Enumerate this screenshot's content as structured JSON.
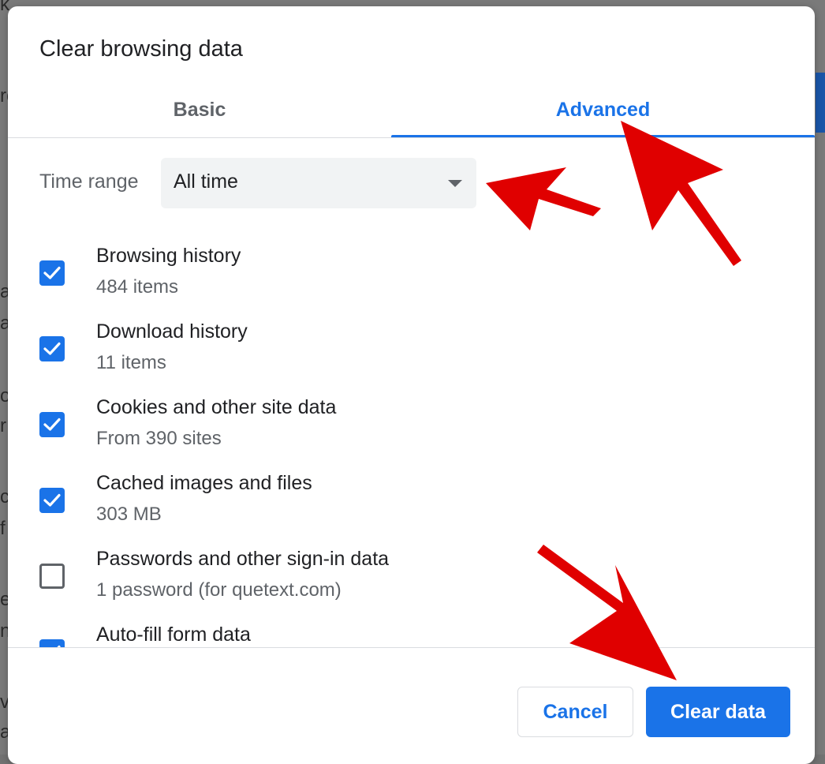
{
  "background": {
    "fragments": [
      "k",
      "rc",
      "a",
      "a",
      "o",
      "r",
      "c",
      "f",
      "e",
      "n",
      "v",
      "a"
    ]
  },
  "dialog": {
    "title": "Clear browsing data",
    "tabs": [
      {
        "label": "Basic",
        "selected": false
      },
      {
        "label": "Advanced",
        "selected": true
      }
    ],
    "time_range": {
      "label": "Time range",
      "value": "All time"
    },
    "items": [
      {
        "label": "Browsing history",
        "sub": "484 items",
        "checked": true
      },
      {
        "label": "Download history",
        "sub": "11 items",
        "checked": true
      },
      {
        "label": "Cookies and other site data",
        "sub": "From 390 sites",
        "checked": true
      },
      {
        "label": "Cached images and files",
        "sub": "303 MB",
        "checked": true
      },
      {
        "label": "Passwords and other sign-in data",
        "sub": "1 password (for quetext.com)",
        "checked": false
      },
      {
        "label": "Auto-fill form data",
        "sub": "",
        "checked": true
      }
    ],
    "buttons": {
      "cancel": "Cancel",
      "clear": "Clear data"
    }
  },
  "colors": {
    "accent": "#1a73e8",
    "arrow": "#e00000"
  }
}
